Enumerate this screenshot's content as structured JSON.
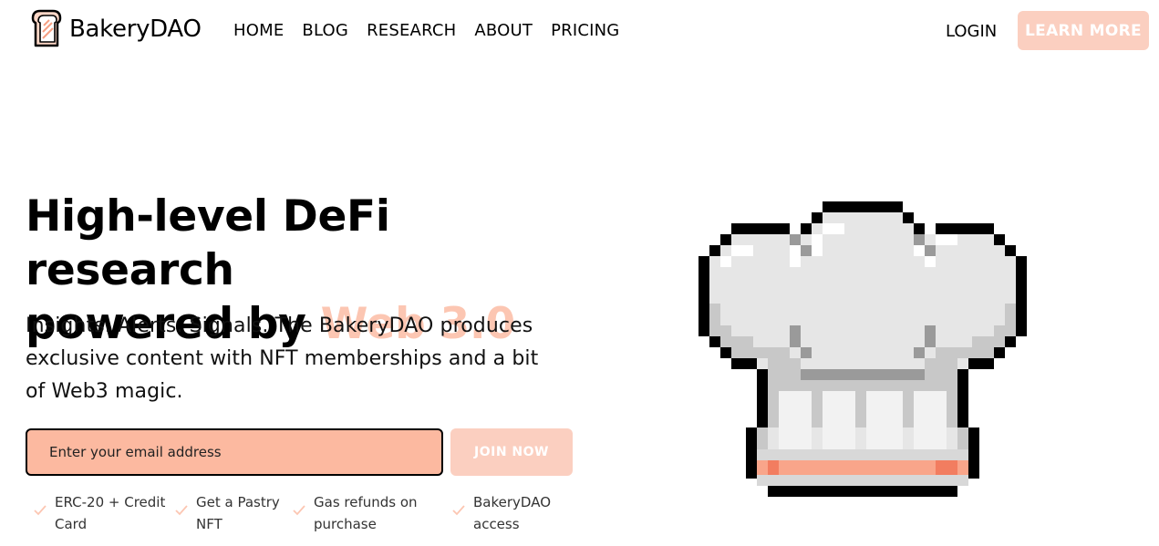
{
  "brand": {
    "name": "BakeryDAO",
    "icon": "toast-logo-icon"
  },
  "nav": {
    "items": [
      {
        "label": "HOME"
      },
      {
        "label": "BLOG"
      },
      {
        "label": "RESEARCH"
      },
      {
        "label": "ABOUT"
      },
      {
        "label": "PRICING"
      }
    ]
  },
  "header": {
    "login_label": "LOGIN",
    "learn_more_label": "LEARN MORE"
  },
  "hero": {
    "headline_line1": "High-level DeFi research",
    "headline_line2_prefix": "powered by",
    "headline_accent": "Web 3.0",
    "subtext": "Insights. Alerts. Signals. The BakeryDAO produces exclusive content with NFT memberships and a bit of Web3 magic.",
    "email_placeholder": "Enter your email address",
    "join_label": "JOIN NOW"
  },
  "features": [
    {
      "label": "ERC-20 + Credit Card",
      "icon": "check-icon"
    },
    {
      "label": "Get a Pastry NFT",
      "icon": "check-icon"
    },
    {
      "label": "Gas refunds on purchase",
      "icon": "check-icon"
    },
    {
      "label": "BakeryDAO access",
      "icon": "check-icon"
    }
  ],
  "illustration": {
    "icon": "chef-hat-icon"
  },
  "colors": {
    "accent": "#fcc6b2",
    "button_bg": "#fbcfc0",
    "input_bg": "#fcb9a0",
    "hat_band": "#f9a58a"
  }
}
